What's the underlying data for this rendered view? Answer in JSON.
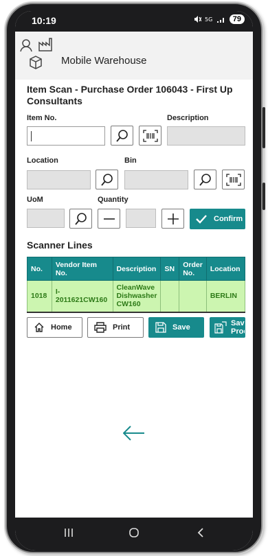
{
  "status_bar": {
    "time": "10:19",
    "battery": "79"
  },
  "app": {
    "title": "Mobile Warehouse"
  },
  "page": {
    "title": "Item Scan - Purchase Order 106043 - First Up Consultants"
  },
  "form": {
    "item_no_label": "Item No.",
    "item_no_value": "",
    "description_label": "Description",
    "location_label": "Location",
    "bin_label": "Bin",
    "uom_label": "UoM",
    "quantity_label": "Quantity",
    "confirm_label": "Confirm"
  },
  "scanner_lines": {
    "title": "Scanner Lines",
    "columns": [
      "No.",
      "Vendor Item No.",
      "Description",
      "SN",
      "Order No.",
      "Location"
    ],
    "rows": [
      {
        "no": "1018",
        "vendor_item_no": "I-2011621CW160",
        "description": "CleanWave Dishwasher CW160",
        "sn": "",
        "order_no": "",
        "location": "BERLIN"
      }
    ]
  },
  "actions": {
    "home": "Home",
    "print": "Print",
    "save": "Save",
    "save_process": "Save & Process"
  },
  "colors": {
    "accent": "#178a8c",
    "row_bg": "#ccf5b0",
    "row_text": "#2d7a17"
  },
  "icons": [
    "user-icon",
    "factory-icon",
    "box-icon",
    "search-icon",
    "barcode-icon",
    "minus-icon",
    "plus-icon",
    "check-icon",
    "home-icon",
    "print-icon",
    "save-icon",
    "back-arrow-icon"
  ]
}
